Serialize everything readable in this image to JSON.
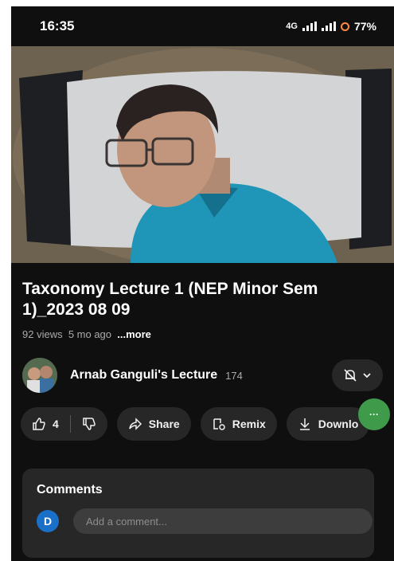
{
  "status_bar": {
    "time": "16:35",
    "network": "4G",
    "battery": "77%"
  },
  "video": {
    "title": "Taxonomy Lecture 1 (NEP Minor Sem 1)_2023 08 09",
    "views": "92 views",
    "age": "5 mo ago",
    "more_label": "...more"
  },
  "channel": {
    "name": "Arnab Ganguli's Lecture",
    "subscribers": "174"
  },
  "actions": {
    "likes": "4",
    "share_label": "Share",
    "remix_label": "Remix",
    "download_label": "Downlo"
  },
  "floating_button": {
    "label": "···"
  },
  "comments": {
    "title": "Comments",
    "avatar_letter": "D",
    "placeholder": "Add a comment..."
  },
  "colors": {
    "background": "#0f0f0f",
    "surface": "#272727",
    "text": "#f1f1f1",
    "secondary_text": "#aaaaaa",
    "comment_avatar": "#1a6fc9",
    "fab": "#3f9b4a"
  },
  "icons": [
    "signal-icon",
    "battery-icon",
    "bell-off-icon",
    "chevron-down-icon",
    "like-icon",
    "dislike-icon",
    "share-icon",
    "remix-icon",
    "download-icon"
  ]
}
